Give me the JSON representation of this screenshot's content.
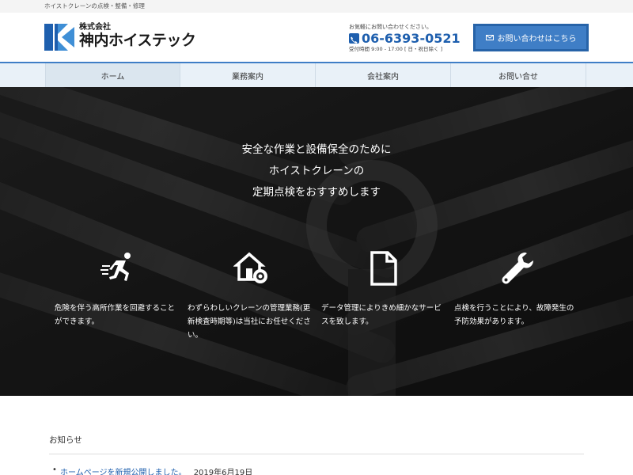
{
  "topbar": {
    "tagline": "ホイストクレーンの点検・整備・修理"
  },
  "logo": {
    "sub": "株式会社",
    "name": "神内ホイステック"
  },
  "contact": {
    "lead": "お気軽にお問い合わせください。",
    "tel": "06-6393-0521",
    "hours": "受付時間 9:00 - 17:00 [ 日・祝日除く ]"
  },
  "cta": {
    "label": "お問い合わせはこちら"
  },
  "nav": {
    "items": [
      {
        "label": "ホーム"
      },
      {
        "label": "業務案内"
      },
      {
        "label": "会社案内"
      },
      {
        "label": "お問い合せ"
      }
    ]
  },
  "hero": {
    "lines": [
      "安全な作業と設備保全のために",
      "ホイストクレーンの",
      "定期点検をおすすめします"
    ],
    "features": [
      {
        "icon": "running-person-icon",
        "text": "危険を伴う高所作業を回避することができます。"
      },
      {
        "icon": "house-gear-icon",
        "text": "わずらわしいクレーンの管理業務(更新検査時期等)は当社にお任せください。"
      },
      {
        "icon": "document-icon",
        "text": "データ管理によりきめ細かなサービスを致します。"
      },
      {
        "icon": "wrench-icon",
        "text": "点検を行うことにより、故障発生の予防効果があります。"
      }
    ]
  },
  "news": {
    "title": "お知らせ",
    "items": [
      {
        "link": "ホームページを新規公開しました。",
        "date": "2019年6月19日"
      }
    ]
  },
  "colors": {
    "brand": "#1e5fae",
    "accent": "#3f7ec6",
    "nav_bg": "#e9f1f8"
  }
}
